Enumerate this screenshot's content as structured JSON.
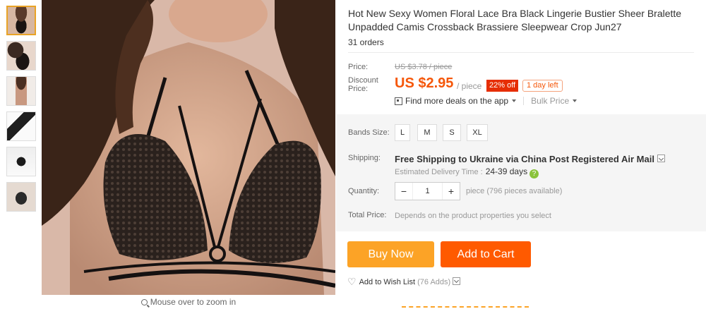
{
  "thumbnails": [
    {
      "alt": "thumb-1"
    },
    {
      "alt": "thumb-2"
    },
    {
      "alt": "thumb-3"
    },
    {
      "alt": "thumb-4"
    },
    {
      "alt": "thumb-5"
    },
    {
      "alt": "thumb-6"
    }
  ],
  "zoom_hint": "Mouse over to zoom in",
  "product": {
    "title": "Hot New Sexy Women Floral Lace Bra Black Lingerie Bustier Sheer Bralette Unpadded Camis Crossback Brassiere Sleepwear Crop Jun27",
    "orders": "31 orders"
  },
  "price": {
    "label": "Price:",
    "original": "US $3.78 / piece",
    "discount_label": "Discount Price:",
    "discount_label_line1": "Discount",
    "discount_label_line2": "Price:",
    "current": "US $2.95",
    "unit": "/ piece",
    "discount_badge": "22% off",
    "time_left": "1 day left",
    "app_deals": "Find more deals on the app",
    "bulk_price": "Bulk Price"
  },
  "options": {
    "bands_label": "Bands Size:",
    "sizes": [
      "L",
      "M",
      "S",
      "XL"
    ]
  },
  "shipping": {
    "label": "Shipping:",
    "main": "Free Shipping to Ukraine via China Post Registered Air Mail",
    "estimate_label": "Estimated Delivery Time :",
    "estimate_days": "24-39  days"
  },
  "quantity": {
    "label": "Quantity:",
    "value": "1",
    "availability": "piece (796 pieces available)"
  },
  "total": {
    "label": "Total Price:",
    "value": "Depends on the product properties you select"
  },
  "actions": {
    "buy_now": "Buy Now",
    "add_to_cart": "Add to Cart",
    "wishlist": "Add to Wish List",
    "wishlist_count": "(76 Adds)"
  },
  "colors": {
    "accent_orange": "#ff5a00",
    "buy_orange": "#fca326",
    "price_red": "#f5570a",
    "badge_red": "#e62e04"
  }
}
